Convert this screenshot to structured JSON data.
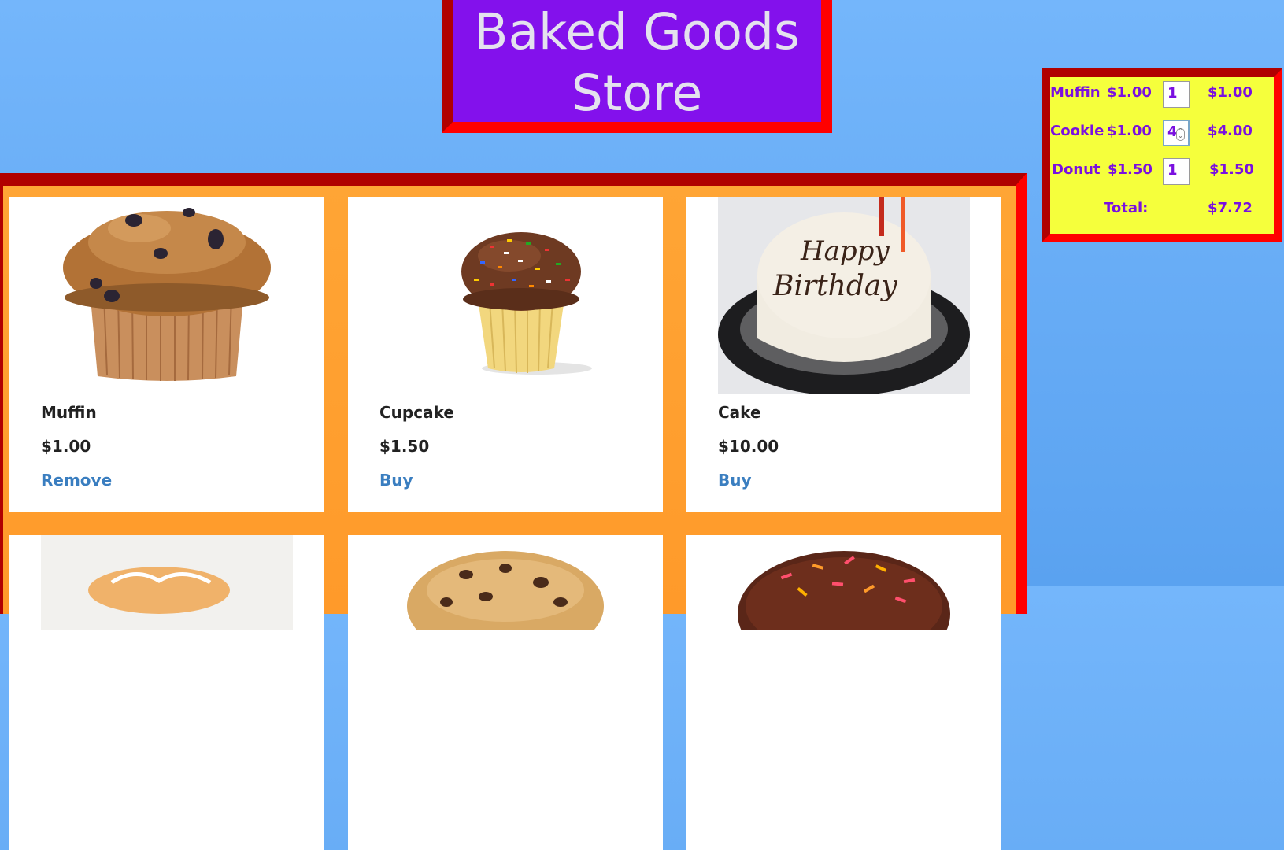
{
  "header": {
    "title_line1": "Baked Goods",
    "title_line2": "Store"
  },
  "products": [
    {
      "name": "Muffin",
      "price": "$1.00",
      "action": "Remove"
    },
    {
      "name": "Cupcake",
      "price": "$1.50",
      "action": "Buy"
    },
    {
      "name": "Cake",
      "price": "$10.00",
      "action": "Buy"
    }
  ],
  "cart": {
    "rows": [
      {
        "name": "Muffin",
        "price": "$1.00",
        "qty": "1",
        "subtotal": "$1.00"
      },
      {
        "name": "Cookie",
        "price": "$1.00",
        "qty": "4",
        "subtotal": "$4.00"
      },
      {
        "name": "Donut",
        "price": "$1.50",
        "qty": "1",
        "subtotal": "$1.50"
      }
    ],
    "total_label": "Total:",
    "total_value": "$7.72"
  },
  "cake_text": {
    "line1": "Happy",
    "line2": "Birthday"
  },
  "colors": {
    "title_bg": "#8311ec",
    "panel_bg": "#ffa535",
    "cart_bg": "#f5ff3c",
    "frame": "#ff0000",
    "link": "#3a7ec0"
  }
}
